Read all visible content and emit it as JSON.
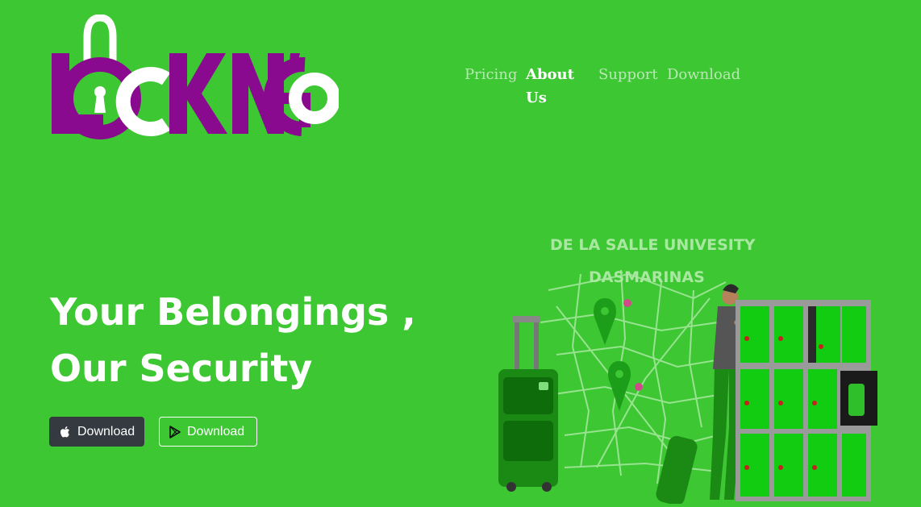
{
  "logo": {
    "text": "LOCK N' GO",
    "alt": "Lock N' Go"
  },
  "nav": {
    "items": [
      {
        "label": "Pricing",
        "active": false
      },
      {
        "label": "About Us",
        "active": true
      },
      {
        "label": "Support",
        "active": false
      },
      {
        "label": "Download",
        "active": false
      }
    ]
  },
  "hero": {
    "title": "Your Belongings , Our Security",
    "buttons": {
      "apple_label": "Download",
      "play_label": "Download"
    }
  },
  "illustration": {
    "heading_line1": "DE LA SALLE UNIVESITY",
    "heading_line2": "DASMARINAS"
  },
  "colors": {
    "background": "#3dc733",
    "logo_purple": "#8a0a8f",
    "nav_inactive": "#b9e8b5",
    "apple_button": "#343a40"
  }
}
